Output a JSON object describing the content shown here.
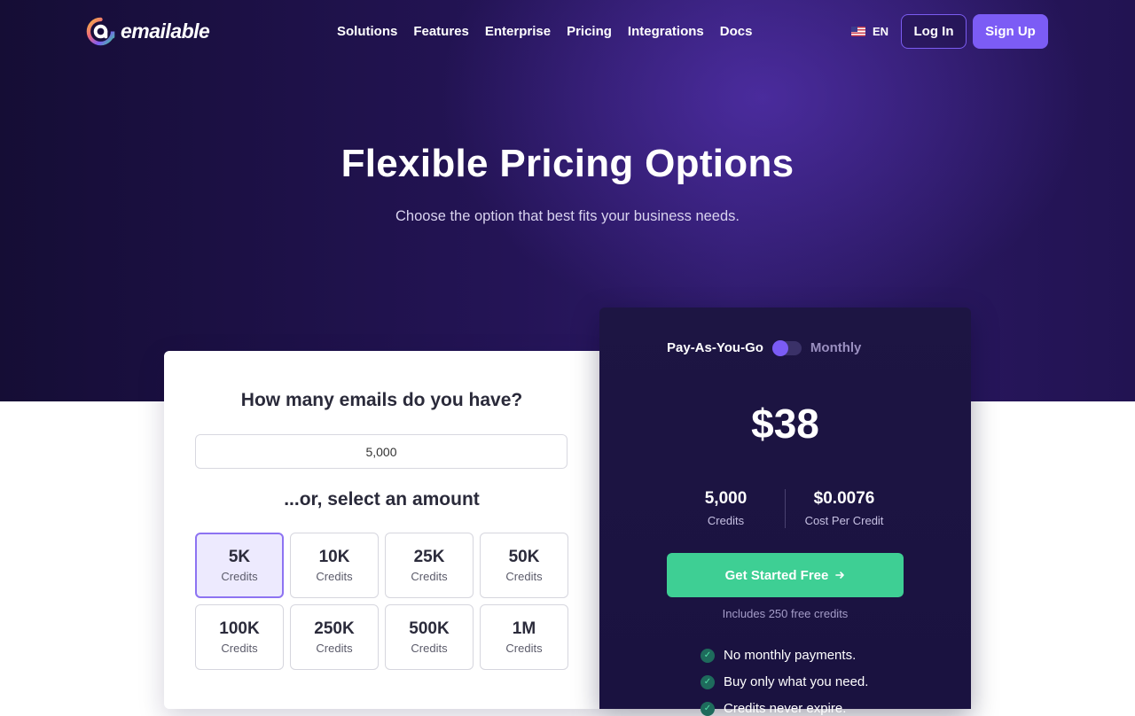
{
  "brand": {
    "name": "emailable"
  },
  "nav": {
    "items": [
      "Solutions",
      "Features",
      "Enterprise",
      "Pricing",
      "Integrations",
      "Docs"
    ],
    "language": "EN",
    "login_label": "Log In",
    "signup_label": "Sign Up"
  },
  "hero": {
    "title": "Flexible Pricing Options",
    "subtitle": "Choose the option that best fits your business needs."
  },
  "calculator": {
    "question": "How many emails do you have?",
    "input_value": "5,000",
    "or_label": "...or, select an amount",
    "options": [
      {
        "value": "5K",
        "label": "Credits",
        "selected": true
      },
      {
        "value": "10K",
        "label": "Credits",
        "selected": false
      },
      {
        "value": "25K",
        "label": "Credits",
        "selected": false
      },
      {
        "value": "50K",
        "label": "Credits",
        "selected": false
      },
      {
        "value": "100K",
        "label": "Credits",
        "selected": false
      },
      {
        "value": "250K",
        "label": "Credits",
        "selected": false
      },
      {
        "value": "500K",
        "label": "Credits",
        "selected": false
      },
      {
        "value": "1M",
        "label": "Credits",
        "selected": false
      }
    ]
  },
  "plan": {
    "toggle_left": "Pay-As-You-Go",
    "toggle_right": "Monthly",
    "price": "$38",
    "credits_value": "5,000",
    "credits_label": "Credits",
    "cost_value": "$0.0076",
    "cost_label": "Cost Per Credit",
    "cta_label": "Get Started Free",
    "includes": "Includes 250 free credits",
    "features": [
      "No monthly payments.",
      "Buy only what you need.",
      "Credits never expire."
    ]
  },
  "colors": {
    "accent": "#7c5cf5",
    "cta": "#3ecf94",
    "hero_bg": "#241456"
  }
}
